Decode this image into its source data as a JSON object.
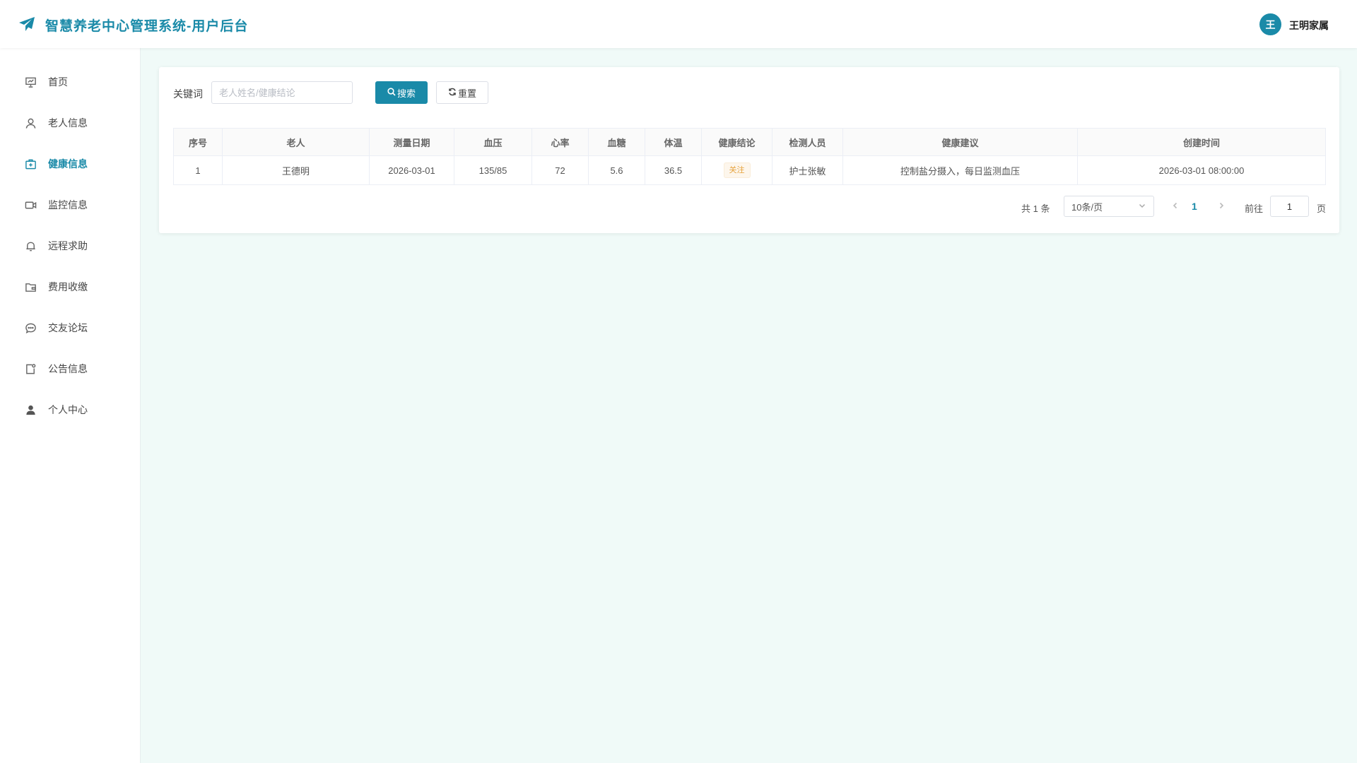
{
  "header": {
    "title": "智慧养老中心管理系统-用户后台",
    "avatar_text": "王",
    "user_name": "王明家属",
    "accent_color": "#1a8aa8"
  },
  "sidebar": {
    "items": [
      {
        "label": "首页",
        "icon": "dashboard-icon"
      },
      {
        "label": "老人信息",
        "icon": "user-icon"
      },
      {
        "label": "健康信息",
        "icon": "medical-kit-icon",
        "active": true
      },
      {
        "label": "监控信息",
        "icon": "video-camera-icon"
      },
      {
        "label": "远程求助",
        "icon": "bell-icon"
      },
      {
        "label": "费用收缴",
        "icon": "wallet-icon"
      },
      {
        "label": "交友论坛",
        "icon": "chat-icon"
      },
      {
        "label": "公告信息",
        "icon": "notice-icon"
      },
      {
        "label": "个人中心",
        "icon": "person-icon"
      }
    ]
  },
  "search": {
    "label": "关键词",
    "placeholder": "老人姓名/健康结论",
    "value": "",
    "search_button": "搜索",
    "reset_button": "重置"
  },
  "table": {
    "columns": [
      "序号",
      "老人",
      "测量日期",
      "血压",
      "心率",
      "血糖",
      "体温",
      "健康结论",
      "检测人员",
      "健康建议",
      "创建时间"
    ],
    "rows": [
      {
        "index": "1",
        "elder": "王德明",
        "date": "2026-03-01",
        "blood_pressure": "135/85",
        "heart_rate": "72",
        "blood_sugar": "5.6",
        "temperature": "36.5",
        "conclusion": "关注",
        "inspector": "护士张敏",
        "advice": "控制盐分摄入，每日监测血压",
        "created_at": "2026-03-01 08:00:00"
      }
    ]
  },
  "pagination": {
    "total_text": "共 1 条",
    "page_size": "10条/页",
    "current_page": "1",
    "goto_label": "前往",
    "goto_value": "1",
    "page_suffix": "页"
  }
}
